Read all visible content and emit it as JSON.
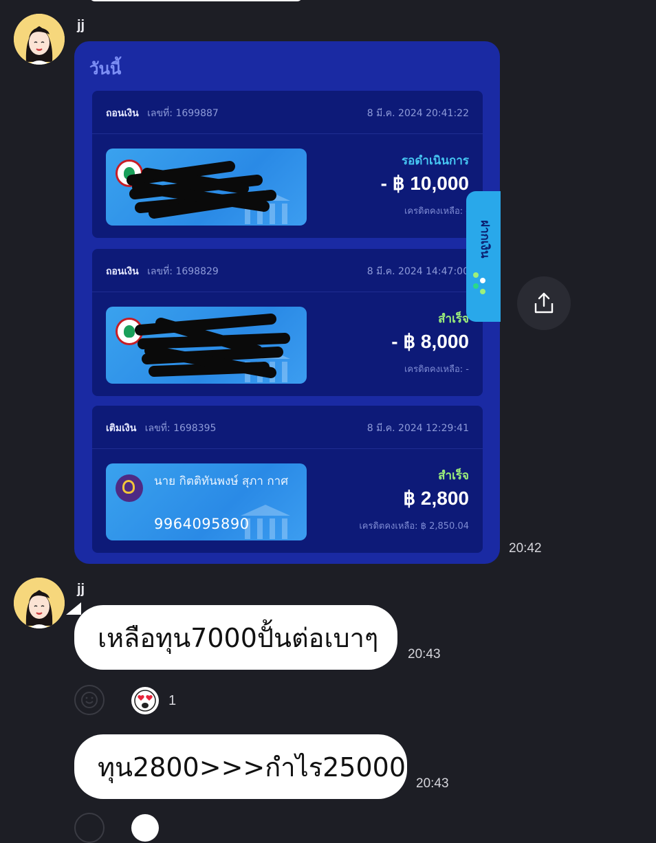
{
  "messages": [
    {
      "sender": "jj",
      "time": "20:42",
      "image": {
        "heading": "วันนี้",
        "side_tab_label": "ฝากเงิน",
        "transactions": [
          {
            "type": "ถอนเงิน",
            "ref_label": "เลขที่: 1699887",
            "date": "8 มี.ค. 2024 20:41:22",
            "status": "รอดำเนินการ",
            "status_kind": "pending",
            "amount": "- ฿ 10,000",
            "credit": "เครดิตคงเหลือ: -",
            "bank": "kbank"
          },
          {
            "type": "ถอนเงิน",
            "ref_label": "เลขที่: 1698829",
            "date": "8 มี.ค. 2024 14:47:00",
            "status": "สำเร็จ",
            "status_kind": "ok",
            "amount": "- ฿ 8,000",
            "credit": "เครดิตคงเหลือ: -",
            "bank": "kbank"
          },
          {
            "type": "เติมเงิน",
            "ref_label": "เลขที่: 1698395",
            "date": "8 มี.ค. 2024 12:29:41",
            "status": "สำเร็จ",
            "status_kind": "ok",
            "amount": "฿ 2,800",
            "credit": "เครดิตคงเหลือ: ฿ 2,850.04",
            "bank": "scb",
            "account_name": "นาย กิตติทันพงษ์ สุภา กาศ",
            "account_number": "9964095890"
          }
        ]
      }
    },
    {
      "sender": "jj",
      "time": "20:43",
      "text": "เหลือทุน7000ปั้นต่อเบาๆ",
      "reaction": {
        "emoji": "heart-eyes",
        "count": "1"
      }
    },
    {
      "time": "20:43",
      "text": "ทุน2800>>>กำไร25000"
    }
  ],
  "colors": {
    "background": "#1d1e25",
    "card_bg": "#1a2aa3",
    "txn_bg": "#0d1a78",
    "pending": "#46c6f2",
    "success": "#9df07a"
  }
}
